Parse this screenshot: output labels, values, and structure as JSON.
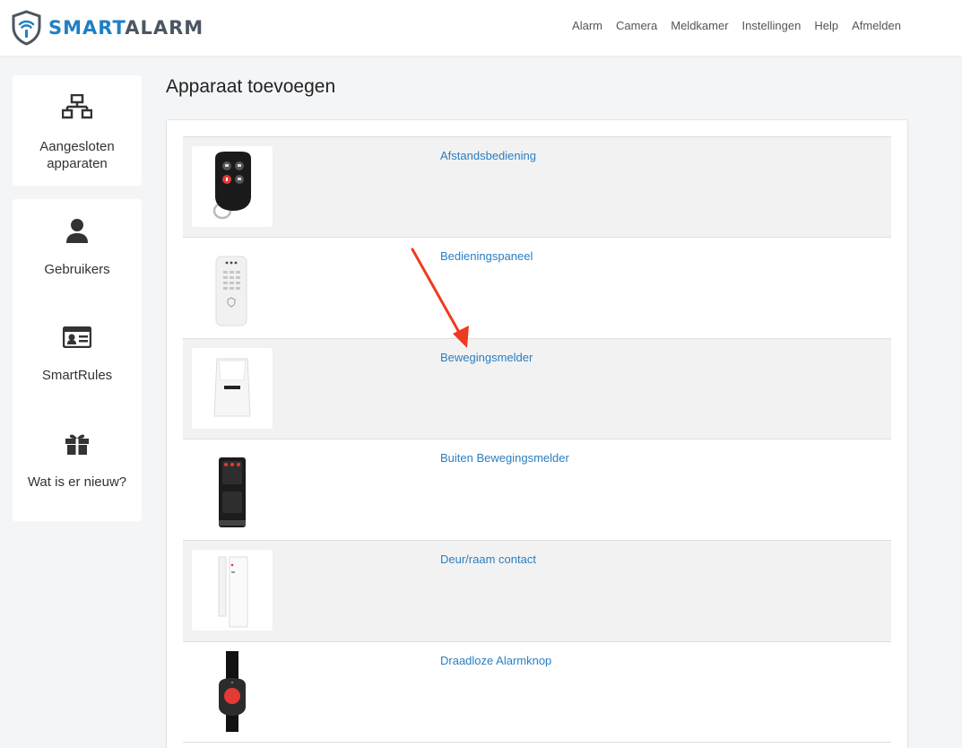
{
  "header": {
    "logo_part1": "SMART",
    "logo_part2": "ALARM",
    "nav": [
      "Alarm",
      "Camera",
      "Meldkamer",
      "Instellingen",
      "Help",
      "Afmelden"
    ]
  },
  "sidebar": {
    "items": [
      {
        "label": "Aangesloten apparaten",
        "icon": "network-icon"
      },
      {
        "label": "Gebruikers",
        "icon": "user-icon"
      },
      {
        "label": "SmartRules",
        "icon": "id-card-icon"
      },
      {
        "label": "Wat is er nieuw?",
        "icon": "gift-icon"
      }
    ]
  },
  "main": {
    "title": "Apparaat toevoegen",
    "devices": [
      {
        "label": "Afstandsbediening",
        "image": "remote-control-image"
      },
      {
        "label": "Bedieningspaneel",
        "image": "keypad-image"
      },
      {
        "label": "Bewegingsmelder",
        "image": "motion-sensor-image"
      },
      {
        "label": "Buiten Bewegingsmelder",
        "image": "outdoor-motion-sensor-image"
      },
      {
        "label": "Deur/raam contact",
        "image": "door-contact-image"
      },
      {
        "label": "Draadloze Alarmknop",
        "image": "panic-button-image"
      }
    ]
  },
  "colors": {
    "accent": "#1f7fc4",
    "link": "#2a7ec0",
    "annotation_arrow": "#f03a1f"
  }
}
